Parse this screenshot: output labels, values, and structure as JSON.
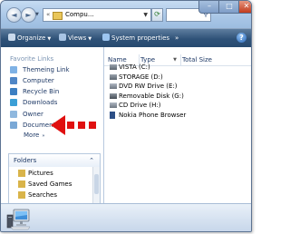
{
  "window": {
    "address": {
      "chevron": "«",
      "text": "Compu...",
      "folder_icon": "folder-icon"
    },
    "nav": {
      "back": "◄",
      "forward": "►"
    },
    "controls": {
      "minimize": "–",
      "maximize": "□",
      "close": "✕"
    }
  },
  "toolbar": {
    "organize": "Organize",
    "views": "Views",
    "system_properties": "System properties",
    "more": "»",
    "help": "?"
  },
  "favorites": {
    "title": "Favorite Links",
    "items": [
      {
        "label": "Themeing Link",
        "icon": "link-icon",
        "color": "#7fb2e5"
      },
      {
        "label": "Computer",
        "icon": "computer-icon",
        "color": "#4f86c6"
      },
      {
        "label": "Recycle Bin",
        "icon": "recycle-bin-icon",
        "color": "#3c7fc2"
      },
      {
        "label": "Downloads",
        "icon": "downloads-icon",
        "color": "#3b9fd6"
      },
      {
        "label": "Owner",
        "icon": "user-folder-icon",
        "color": "#8fb8de"
      },
      {
        "label": "Documents",
        "icon": "documents-icon",
        "color": "#7aa8d6"
      }
    ],
    "more": "More",
    "more_chev": "»"
  },
  "folders": {
    "title": "Folders",
    "chevron": "⌃",
    "items": [
      {
        "label": "Pictures",
        "icon": "pictures-folder-icon",
        "color": "#d9b44a"
      },
      {
        "label": "Saved Games",
        "icon": "games-folder-icon",
        "color": "#d9b44a"
      },
      {
        "label": "Searches",
        "icon": "search-folder-icon",
        "color": "#d9b44a"
      }
    ]
  },
  "columns": {
    "name": "Name",
    "type": "Type",
    "total_size": "Total Size"
  },
  "drives": [
    {
      "label": "VISTA (C:)",
      "icon": "hard-drive-icon"
    },
    {
      "label": "STORAGE (D:)",
      "icon": "hard-drive-icon"
    },
    {
      "label": "DVD RW Drive (E:)",
      "icon": "dvd-drive-icon"
    },
    {
      "label": "Removable Disk (G:)",
      "icon": "removable-disk-icon"
    },
    {
      "label": "CD Drive (H:)",
      "icon": "cd-drive-icon"
    },
    {
      "label": "Nokia Phone Browser",
      "icon": "phone-icon"
    }
  ],
  "annotation": {
    "arrow_color": "#e01010",
    "icon": "red-arrow-icon"
  }
}
